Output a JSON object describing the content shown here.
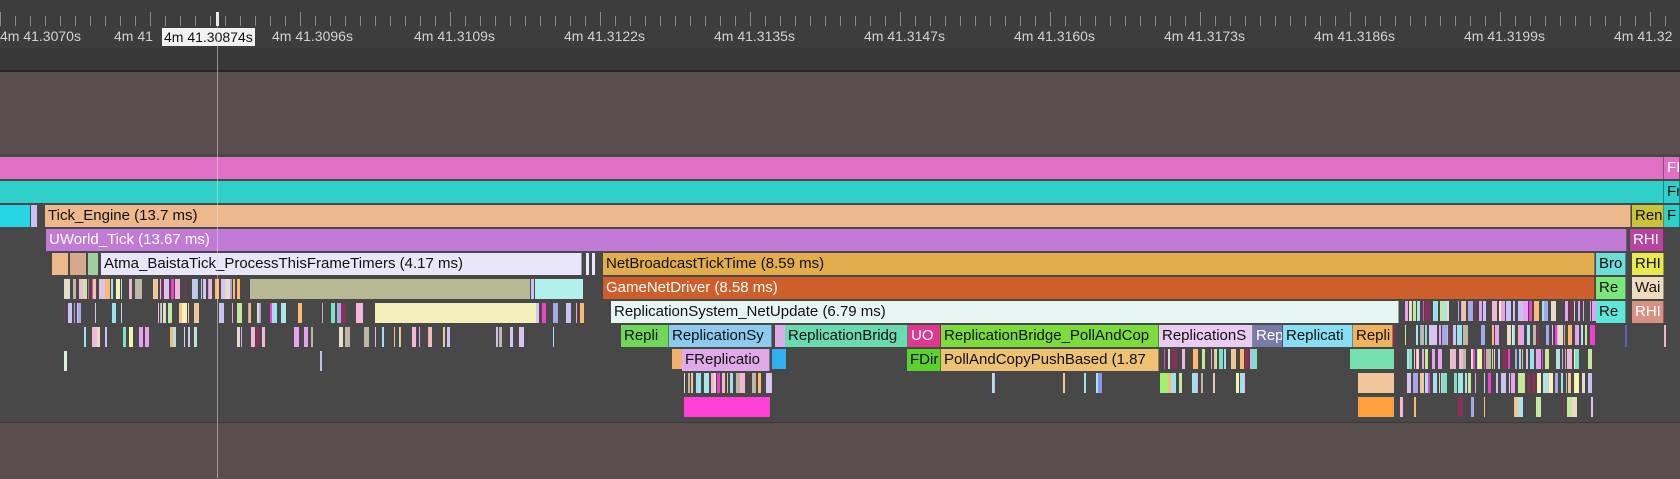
{
  "ruler": {
    "labels": [
      "4m 41.3070s",
      "4m 41",
      "4m 41.3096s",
      "4m 41.3109s",
      "4m 41.3122s",
      "4m 41.3135s",
      "4m 41.3147s",
      "4m 41.3160s",
      "4m 41.3173s",
      "4m 41.3186s",
      "4m 41.3199s",
      "4m 41.32"
    ],
    "cursor_label": "4m 41.30874s"
  },
  "events": [
    {
      "name": "frame-event-top",
      "label": "FI",
      "color": "#e070c4"
    },
    {
      "name": "frame-event-left",
      "label": "",
      "color": "#e070c4"
    },
    {
      "name": "frame-track-event",
      "label": "",
      "color": "#2fcfca"
    },
    {
      "name": "frame-track-event-right",
      "label": "Fr",
      "color": "#2fcfca"
    },
    {
      "name": "tick-engine-event",
      "label": "Tick_Engine (13.7 ms)",
      "color": "#edb98c"
    },
    {
      "name": "render-event",
      "label": "Ren",
      "color": "#c8c43a"
    },
    {
      "name": "frame-sub-event",
      "label": "F",
      "color": "#2fcfca"
    },
    {
      "name": "uworld-tick-event",
      "label": "UWorld_Tick (13.67 ms)",
      "color": "#c17ad6"
    },
    {
      "name": "rhi-event",
      "label": "RHI",
      "color": "#b5459e"
    },
    {
      "name": "atma-tick-event",
      "label": "Atma_BaistaTick_ProcessThisFrameTimers (4.17 ms)",
      "color": "#e9e6fa"
    },
    {
      "name": "net-broadcast-event",
      "label": "NetBroadcastTickTime (8.59 ms)",
      "color": "#e2ad4c"
    },
    {
      "name": "broadcast-event",
      "label": "Bro",
      "color": "#6edcd7"
    },
    {
      "name": "rhi-event-2",
      "label": "RHI",
      "color": "#e9e94f"
    },
    {
      "name": "game-net-driver-event",
      "label": "GameNetDriver (8.58 ms)",
      "color": "#cf5f2a"
    },
    {
      "name": "re-event",
      "label": "Re",
      "color": "#7ce67c"
    },
    {
      "name": "wait-event",
      "label": "Wai",
      "color": "#efdcc0"
    },
    {
      "name": "replication-netupdate-event",
      "label": "ReplicationSystem_NetUpdate (6.79 ms)",
      "color": "#e6f6f2"
    },
    {
      "name": "re-event-2",
      "label": "Re",
      "color": "#5ee6d8"
    },
    {
      "name": "rhi-event-3",
      "label": "RHI",
      "color": "#d99183"
    },
    {
      "name": "repli-event",
      "label": "Repli",
      "color": "#70d858"
    },
    {
      "name": "replication-sy-event",
      "label": "ReplicationSy",
      "color": "#8ccbee"
    },
    {
      "name": "replication-bridg-event",
      "label": "ReplicationBridg",
      "color": "#6adbb0"
    },
    {
      "name": "uo-event",
      "label": "UO",
      "color": "#e0388f"
    },
    {
      "name": "poll-and-cop-event",
      "label": "ReplicationBridge_PollAndCop",
      "color": "#7bdc3c"
    },
    {
      "name": "replication-s-event",
      "label": "ReplicationS",
      "color": "#eaccf2"
    },
    {
      "name": "rep-event",
      "label": "Rep",
      "color": "#7a7aa8"
    },
    {
      "name": "replicati-event",
      "label": "Replicati",
      "color": "#87def5"
    },
    {
      "name": "repli-event-2",
      "label": "Repli",
      "color": "#f0b25c"
    },
    {
      "name": "freplicatio-event",
      "label": "FReplicatio",
      "color": "#e0a9e8"
    },
    {
      "name": "fdir-event",
      "label": "FDir",
      "color": "#5ad12c"
    },
    {
      "name": "poll-push-event",
      "label": "PollAndCopyPushBased (1.87",
      "color": "#eec274"
    }
  ]
}
